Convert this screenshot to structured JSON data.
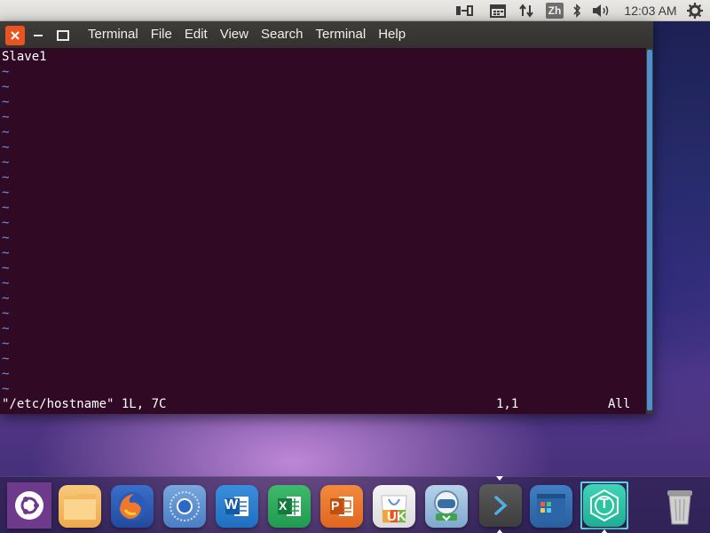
{
  "top_panel": {
    "input_method": "Zh",
    "clock": "12:03 AM",
    "indicators": [
      "keyboard-layout-icon",
      "calendar-icon",
      "network-transfer-icon",
      "input-method-icon",
      "bluetooth-icon",
      "volume-icon",
      "clock",
      "system-gear-icon"
    ]
  },
  "window": {
    "menu": {
      "app": "Terminal",
      "file": "File",
      "edit": "Edit",
      "view": "View",
      "search": "Search",
      "terminal": "Terminal",
      "help": "Help"
    },
    "terminal": {
      "first_line": "Slave1",
      "empty_line_marker": "~",
      "empty_line_count": 22,
      "status_file": "\"/etc/hostname\" 1L, 7C",
      "status_position": "1,1",
      "status_scroll": "All",
      "background": "#300a24"
    }
  },
  "dock": {
    "items": [
      {
        "name": "ubuntu-dash-icon"
      },
      {
        "name": "files-icon"
      },
      {
        "name": "firefox-icon"
      },
      {
        "name": "chromium-icon"
      },
      {
        "name": "wps-writer-icon",
        "label": "W"
      },
      {
        "name": "wps-spreadsheets-icon",
        "label": "X"
      },
      {
        "name": "wps-presentation-icon",
        "label": "P"
      },
      {
        "name": "software-center-icon",
        "label": "UK"
      },
      {
        "name": "software-updater-icon"
      },
      {
        "name": "terminal-icon"
      },
      {
        "name": "workspace-switcher-icon"
      },
      {
        "name": "app-icon-t",
        "label": "T"
      },
      {
        "name": "trash-icon"
      }
    ]
  },
  "colors": {
    "accent_orange": "#e95420",
    "terminal_bg": "#300a24",
    "tilde": "#7a8fd8",
    "active_frame": "#62d0dd"
  }
}
